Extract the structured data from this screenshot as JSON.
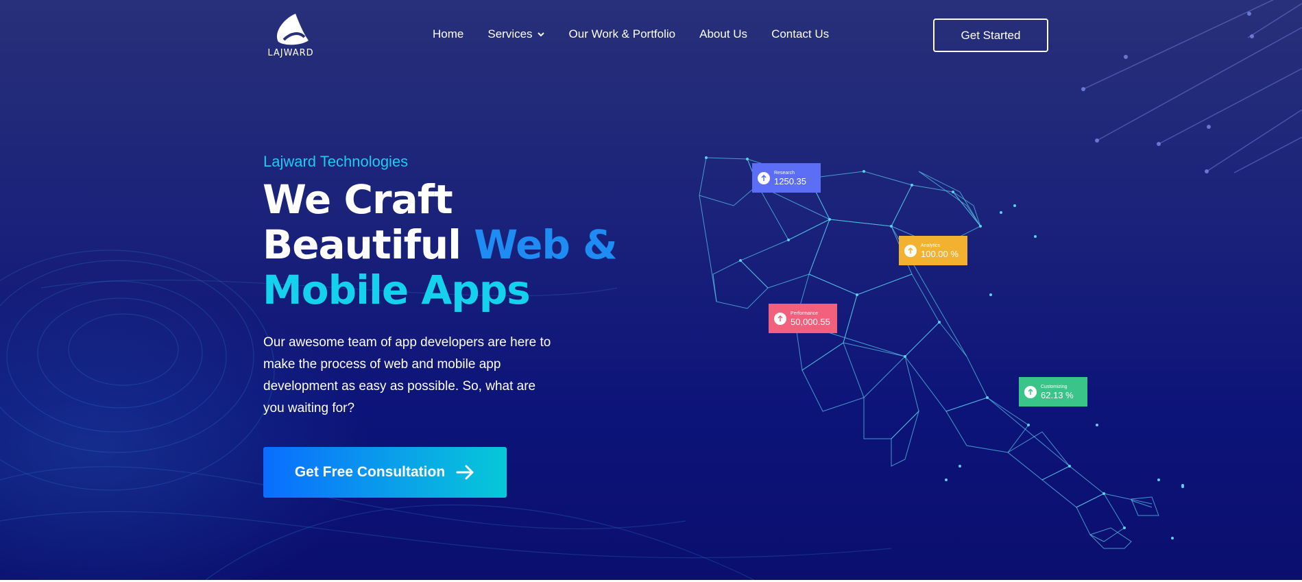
{
  "brand": {
    "name": "Lajward"
  },
  "nav": {
    "items": [
      {
        "label": "Home"
      },
      {
        "label": "Services"
      },
      {
        "label": "Our Work & Portfolio"
      },
      {
        "label": "About Us"
      },
      {
        "label": "Contact Us"
      }
    ],
    "cta_label": "Get Started"
  },
  "hero": {
    "eyebrow": "Lajward Technologies",
    "headline_line1": "We Craft",
    "headline_line2_white": "Beautiful ",
    "headline_line2_blue": "Web &",
    "headline_line3": "Mobile Apps",
    "description": "Our awesome team of app developers are here to make the process of web and mobile app development as easy as possible. So, what are you waiting for?",
    "cta_label": "Get Free Consultation"
  },
  "stats": [
    {
      "label": "Research",
      "value": "1250.35",
      "color": "#5b6ef5",
      "icon": "arrow-up-icon"
    },
    {
      "label": "Analytics",
      "value": "100.00 %",
      "color": "#f2b12f",
      "icon": "arrow-up-icon"
    },
    {
      "label": "Performance",
      "value": "50,000.55",
      "color": "#f2607b",
      "icon": "arrow-up-icon"
    },
    {
      "label": "Customizing",
      "value": "62.13 %",
      "color": "#3bc48a",
      "icon": "arrow-up-icon"
    }
  ],
  "colors": {
    "accent_cyan": "#22c9f0",
    "accent_blue": "#1f8cf4",
    "bg_top": "#28307a",
    "bg_bottom": "#0a0f6e"
  }
}
